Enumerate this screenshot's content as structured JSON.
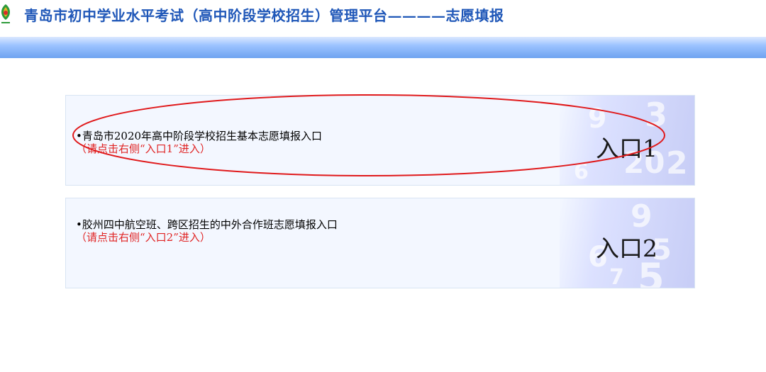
{
  "header": {
    "title": "青岛市初中学业水平考试（高中阶段学校招生）管理平台————志愿填报"
  },
  "panels": [
    {
      "description": "青岛市2020年高中阶段学校招生基本志愿填报入口",
      "hint": "（请点击右侧“入口1”进入）",
      "entry_label": "入口1"
    },
    {
      "description": "胶州四中航空班、跨区招生的中外合作班志愿填报入口",
      "hint": "（请点击右侧“入口2”进入）",
      "entry_label": "入口2"
    }
  ],
  "colors": {
    "title": "#1f57b8",
    "hint": "#e02424",
    "annotation": "#e0191b"
  }
}
